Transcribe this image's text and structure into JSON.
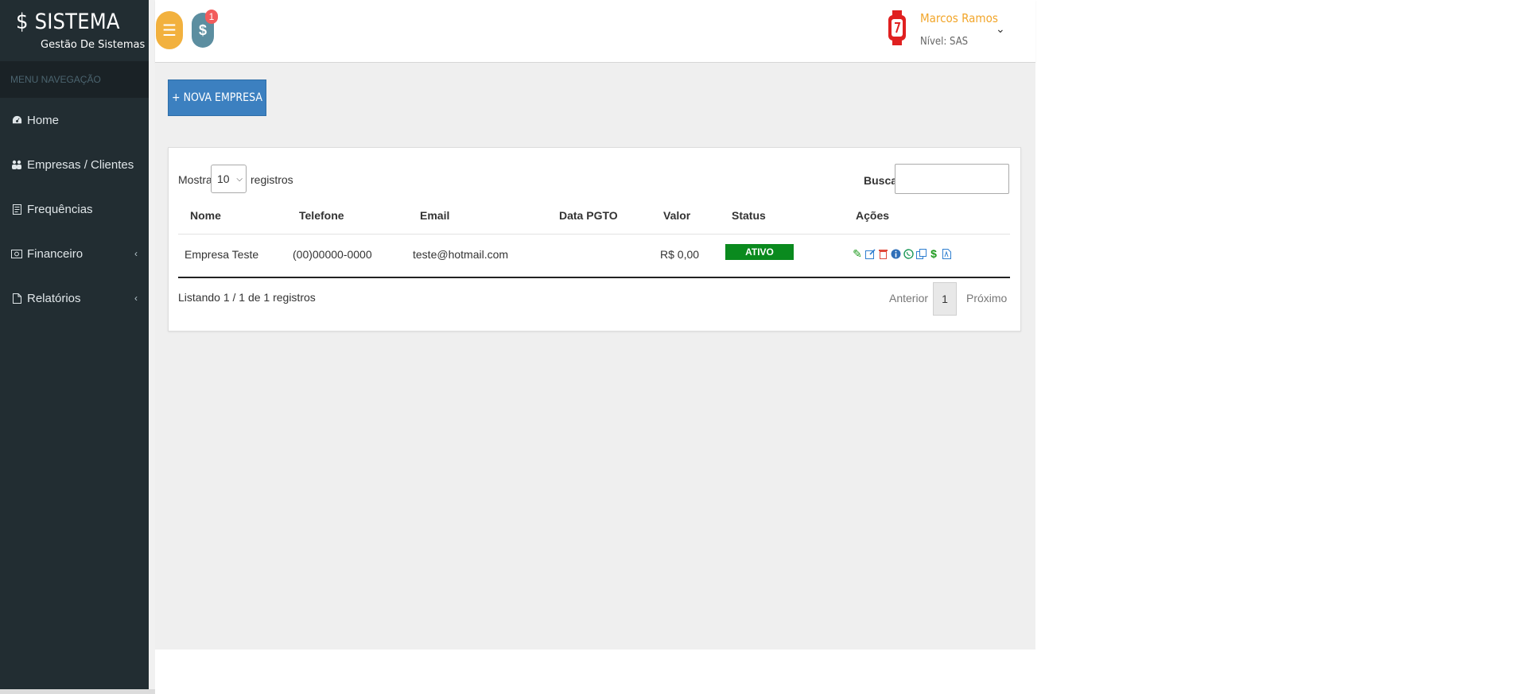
{
  "brand": {
    "title": "$ SISTEMA",
    "subtitle": "Gestão De Sistemas"
  },
  "sidebar": {
    "header": "MENU NAVEGAÇÃO",
    "items": [
      {
        "label": "Home",
        "icon": "dashboard-icon"
      },
      {
        "label": "Empresas / Clientes",
        "icon": "users-icon"
      },
      {
        "label": "Frequências",
        "icon": "document-icon"
      },
      {
        "label": "Financeiro",
        "icon": "money-icon",
        "has_submenu": true
      },
      {
        "label": "Relatórios",
        "icon": "file-icon",
        "has_submenu": true
      }
    ]
  },
  "topbar": {
    "menu_icon": "hamburger-icon",
    "money_icon": "dollar-icon",
    "notification_count": "1",
    "user_name": "Marcos Ramos",
    "user_level": "Nível: SAS",
    "colors": {
      "menu_button": "#f2b13e",
      "money_button": "#5c8ea0",
      "badge": "#f25c5c",
      "user_name": "#f2a62b"
    }
  },
  "main": {
    "new_button": "+ NOVA EMPRESA",
    "show_label": "Mostrar",
    "show_value": "10",
    "records_label": "registros",
    "search_label": "Buscar:",
    "search_value": "",
    "columns": [
      "Nome",
      "Telefone",
      "Email",
      "Data PGTO",
      "Valor",
      "Status",
      "Ações"
    ],
    "rows": [
      {
        "nome": "Empresa Teste",
        "telefone": "(00)00000-0000",
        "email": "teste@hotmail.com",
        "data_pgto": "",
        "valor": "R$ 0,00",
        "status": "ATIVO",
        "actions": [
          "pencil-icon",
          "edit-icon",
          "trash-icon",
          "info-icon",
          "whatsapp-icon",
          "copy-icon",
          "dollar-icon",
          "pdf-icon"
        ]
      }
    ],
    "info": "Listando 1 / 1 de 1 registros",
    "pagination": {
      "previous": "Anterior",
      "current": "1",
      "next": "Próximo"
    },
    "colors": {
      "primary_button": "#3c80c0",
      "status_active": "#0a8a1e"
    }
  }
}
